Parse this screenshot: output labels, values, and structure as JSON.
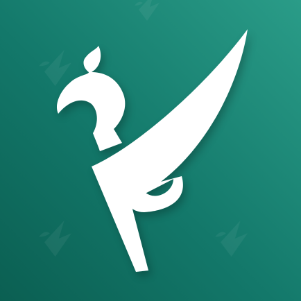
{
  "icon": {
    "name": "griffin-wing-logo",
    "colors": {
      "background_light": "#2a9c88",
      "background_mid": "#13786a",
      "background_dark": "#0b5f52",
      "mark": "#ffffff",
      "watermark": "#ffffff"
    }
  }
}
